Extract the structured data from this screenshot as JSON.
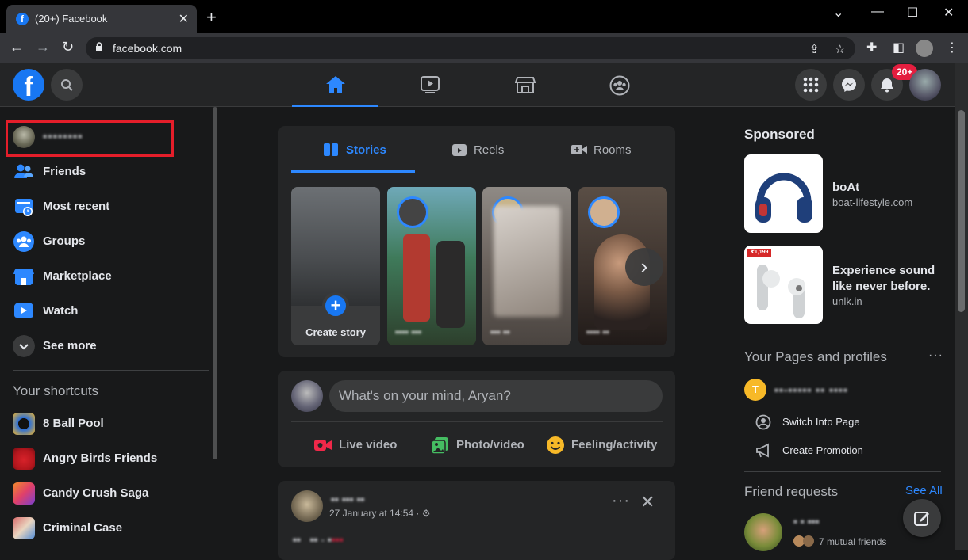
{
  "browser": {
    "tab_title": "(20+) Facebook",
    "url": "facebook.com"
  },
  "header": {
    "logo_letter": "f",
    "notification_badge": "20+",
    "accent": "#2d88ff"
  },
  "sidebar": {
    "profile_name": "▪▪▪▪▪▪▪▪",
    "items": [
      {
        "label": "Friends",
        "icon": "friends-icon"
      },
      {
        "label": "Most recent",
        "icon": "most-recent-icon"
      },
      {
        "label": "Groups",
        "icon": "groups-icon"
      },
      {
        "label": "Marketplace",
        "icon": "marketplace-icon"
      },
      {
        "label": "Watch",
        "icon": "watch-icon"
      },
      {
        "label": "See more",
        "icon": "chevron-down-icon"
      }
    ],
    "shortcuts_title": "Your shortcuts",
    "shortcuts": [
      {
        "label": "8 Ball Pool"
      },
      {
        "label": "Angry Birds Friends"
      },
      {
        "label": "Candy Crush Saga"
      },
      {
        "label": "Criminal Case"
      }
    ]
  },
  "stories": {
    "tabs": [
      {
        "label": "Stories"
      },
      {
        "label": "Reels"
      },
      {
        "label": "Rooms"
      }
    ],
    "create_label": "Create story",
    "plus": "+",
    "next": "›"
  },
  "composer": {
    "placeholder": "What's on your mind, Aryan?",
    "actions": [
      {
        "label": "Live video"
      },
      {
        "label": "Photo/video"
      },
      {
        "label": "Feeling/activity"
      }
    ]
  },
  "post": {
    "timestamp": "27 January at 14:54 · ⚙",
    "more": "···",
    "close": "✕"
  },
  "right": {
    "sponsored_title": "Sponsored",
    "ads": [
      {
        "title": "boAt",
        "site": "boat-lifestyle.com"
      },
      {
        "title": "Experience sound like never before.",
        "site": "unlk.in",
        "price_tag": "₹1,199"
      }
    ],
    "pages_title": "Your Pages and profiles",
    "pages_more": "···",
    "page_initial": "T",
    "page_actions": [
      {
        "label": "Switch Into Page"
      },
      {
        "label": "Create Promotion"
      }
    ],
    "friend_requests_title": "Friend requests",
    "see_all": "See All",
    "mutual": "7 mutual friends"
  }
}
